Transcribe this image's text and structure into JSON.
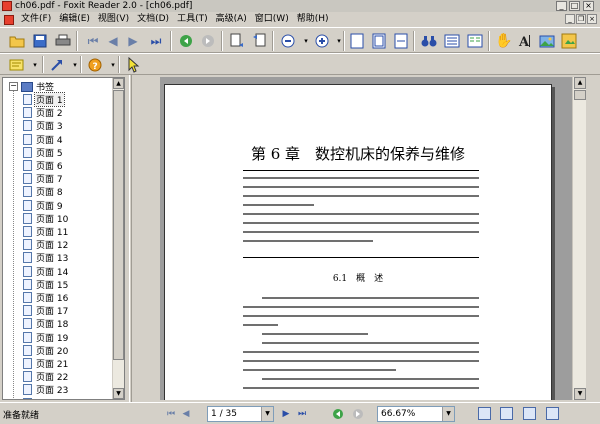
{
  "window": {
    "title": "ch06.pdf - Foxit Reader 2.0 - [ch06.pdf]"
  },
  "menu": {
    "items": [
      "文件(F)",
      "编辑(E)",
      "视图(V)",
      "文档(D)",
      "工具(T)",
      "高级(A)",
      "窗口(W)",
      "帮助(H)"
    ]
  },
  "sidebar": {
    "root_label": "书签",
    "items": [
      {
        "label": "页面 1"
      },
      {
        "label": "页面 2"
      },
      {
        "label": "页面 3"
      },
      {
        "label": "页面 4"
      },
      {
        "label": "页面 5"
      },
      {
        "label": "页面 6"
      },
      {
        "label": "页面 7"
      },
      {
        "label": "页面 8"
      },
      {
        "label": "页面 9"
      },
      {
        "label": "页面 10"
      },
      {
        "label": "页面 11"
      },
      {
        "label": "页面 12"
      },
      {
        "label": "页面 13"
      },
      {
        "label": "页面 14"
      },
      {
        "label": "页面 15"
      },
      {
        "label": "页面 16"
      },
      {
        "label": "页面 17"
      },
      {
        "label": "页面 18"
      },
      {
        "label": "页面 19"
      },
      {
        "label": "页面 20"
      },
      {
        "label": "页面 21"
      },
      {
        "label": "页面 22"
      },
      {
        "label": "页面 23"
      },
      {
        "label": "页面 24"
      }
    ],
    "selected_index": 0
  },
  "document": {
    "chapter_title": "第 6 章　数控机床的保养与维修",
    "section_title": "6.1　概　述"
  },
  "status": {
    "text": "准备就绪",
    "page_indicator": "1 / 35",
    "zoom": "66.67%"
  },
  "colors": {
    "accent": "#e7402e",
    "highlight": "#f3e236",
    "doc_bg": "#9d9d9d"
  }
}
